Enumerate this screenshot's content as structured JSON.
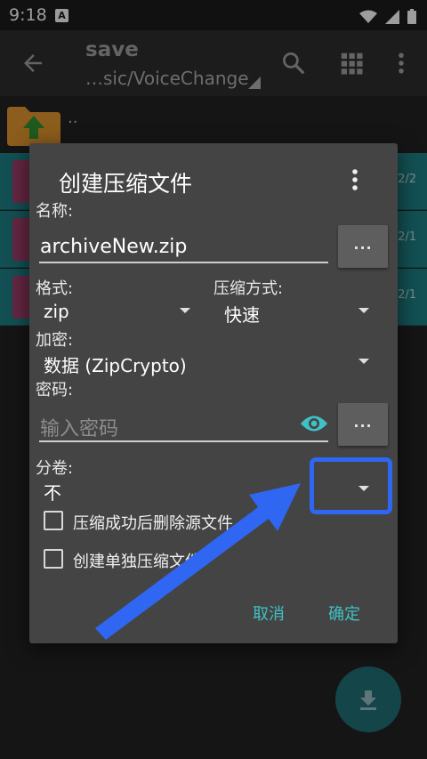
{
  "status_bar": {
    "time": "9:18",
    "badge": "A"
  },
  "toolbar": {
    "title": "save",
    "path": "…sic/VoiceChange",
    "icons": [
      "back-arrow-icon",
      "search-icon",
      "grid-view-icon",
      "more-vert-icon"
    ]
  },
  "file_list": {
    "up_label": "..",
    "rows": [
      {
        "count": "2/2"
      },
      {
        "count": "2/1"
      },
      {
        "count": "2/1"
      }
    ]
  },
  "dialog": {
    "title": "创建压缩文件",
    "name_label": "名称:",
    "name_value": "archiveNew.zip",
    "browse_label": "...",
    "format_label": "格式:",
    "format_value": "zip",
    "method_label": "压缩方式:",
    "method_value": "快速",
    "encryption_label": "加密:",
    "encryption_value": "数据 (ZipCrypto)",
    "password_label": "密码:",
    "password_placeholder": "输入密码",
    "password_more_label": "...",
    "split_label": "分卷:",
    "split_value": "不",
    "delete_source_label": "压缩成功后删除源文件",
    "delete_source_checked": false,
    "separate_archive_label": "创建单独压缩文件",
    "separate_archive_checked": false,
    "cancel_label": "取消",
    "ok_label": "确定"
  },
  "colors": {
    "accent": "#3fc1c5",
    "dialog_bg": "#444444",
    "selected_row": "#1e7c80",
    "annotation": "#2f66f2"
  }
}
